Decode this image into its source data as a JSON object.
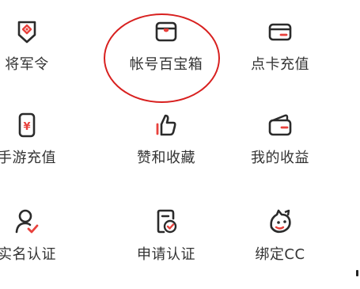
{
  "colors": {
    "icon_stroke": "#2b2b2b",
    "accent": "#e8413c",
    "label_text": "#333333",
    "highlight_circle": "#d8201f"
  },
  "grid": {
    "items": [
      {
        "label": "将军令",
        "icon": "shield-token-icon"
      },
      {
        "label": "帐号百宝箱",
        "icon": "treasure-box-icon"
      },
      {
        "label": "点卡充值",
        "icon": "card-icon"
      },
      {
        "label": "手游充值",
        "icon": "phone-yuan-icon"
      },
      {
        "label": "赞和收藏",
        "icon": "thumbs-up-icon"
      },
      {
        "label": "我的收益",
        "icon": "wallet-icon"
      },
      {
        "label": "实名认证",
        "icon": "user-check-icon"
      },
      {
        "label": "申请认证",
        "icon": "document-check-icon"
      },
      {
        "label": "绑定CC",
        "icon": "cc-mascot-icon"
      }
    ]
  }
}
